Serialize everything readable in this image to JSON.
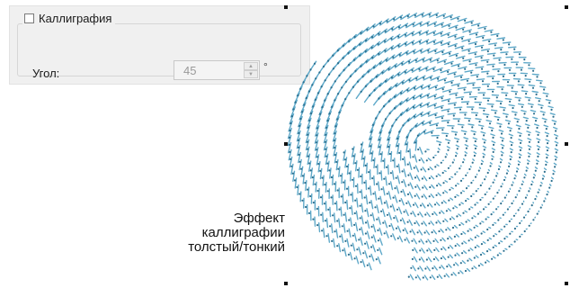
{
  "calligraphy": {
    "checkbox_label": "Каллиграфия",
    "checked": false
  },
  "angle": {
    "label": "Угол:",
    "value": "45",
    "unit": "°"
  },
  "caption": {
    "line1": "Эффект",
    "line2": "каллиграфии",
    "line3": "толстый/тонкий"
  },
  "preview": {
    "stitch_color": "#5fa9c9",
    "handle_color": "#111111"
  }
}
